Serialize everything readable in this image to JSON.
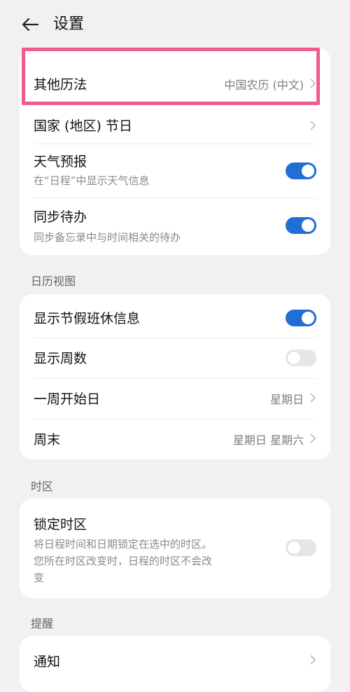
{
  "header": {
    "title": "设置"
  },
  "card1": {
    "other_calendar": {
      "title": "其他历法",
      "value": "中国农历 (中文)"
    },
    "holidays": {
      "title": "国家 (地区) 节日"
    },
    "weather": {
      "title": "天气预报",
      "subtitle": "在“日程”中显示天气信息",
      "enabled": true
    },
    "todo_sync": {
      "title": "同步待办",
      "subtitle": "同步备忘录中与时间相关的待办",
      "enabled": true
    }
  },
  "calendar_view": {
    "section_label": "日历视图",
    "holiday_info": {
      "title": "显示节假班休信息",
      "enabled": true
    },
    "week_numbers": {
      "title": "显示周数",
      "enabled": false
    },
    "week_start": {
      "title": "一周开始日",
      "value": "星期日"
    },
    "weekend": {
      "title": "周末",
      "value": "星期日 星期六"
    }
  },
  "timezone": {
    "section_label": "时区",
    "lock": {
      "title": "锁定时区",
      "subtitle_line1": "将日程时间和日期锁定在选中的时区。",
      "subtitle_line2": "您所在时区改变时，日程的时区不会改",
      "subtitle_line3": "变",
      "enabled": false
    }
  },
  "reminder": {
    "section_label": "提醒",
    "notification": {
      "title": "通知"
    }
  },
  "colors": {
    "accent": "#1f6fd6",
    "highlight": "#ef5b8a",
    "background": "#f1f1f3"
  }
}
